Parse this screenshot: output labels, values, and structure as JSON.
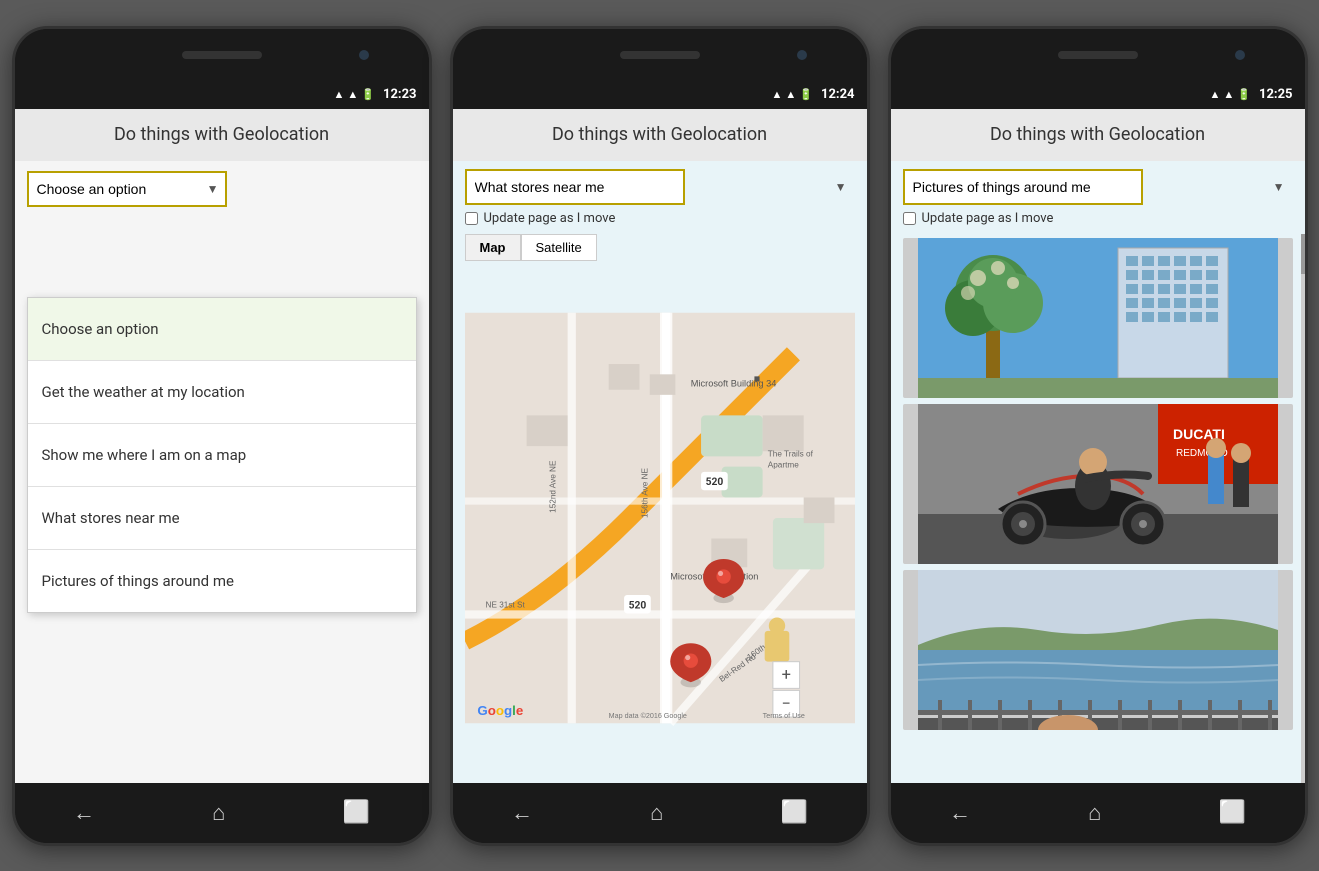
{
  "phones": [
    {
      "id": "phone1",
      "status_bar": {
        "time": "12:23"
      },
      "app_title": "Do things with Geolocation",
      "dropdown": {
        "label": "Choose an option",
        "arrow": "▼"
      },
      "options": [
        {
          "label": "Choose an option",
          "selected": true
        },
        {
          "label": "Get the weather at my location",
          "selected": false
        },
        {
          "label": "Show me where I am on a map",
          "selected": false
        },
        {
          "label": "What stores near me",
          "selected": false
        },
        {
          "label": "Pictures of things around me",
          "selected": false
        }
      ],
      "nav": {
        "back": "←",
        "home": "⌂",
        "recents": "⬜"
      }
    },
    {
      "id": "phone2",
      "status_bar": {
        "time": "12:24"
      },
      "app_title": "Do things with Geolocation",
      "dropdown": {
        "label": "What stores near me",
        "arrow": "▼"
      },
      "checkbox_label": "Update page as I move",
      "map_tabs": [
        "Map",
        "Satellite"
      ],
      "map_labels": {
        "microsoft_building": "Microsoft Building 34",
        "microsoft_corp": "Microsoft Corporation",
        "trails": "The Trails of Apartme",
        "google": "Google",
        "copyright": "Map data ©2016 Google",
        "terms": "Terms of Use",
        "road_520": "520",
        "road_520b": "520"
      },
      "nav": {
        "back": "←",
        "home": "⌂",
        "recents": "⬜"
      }
    },
    {
      "id": "phone3",
      "status_bar": {
        "time": "12:25"
      },
      "app_title": "Do things with Geolocation",
      "dropdown": {
        "label": "Pictures of things around me",
        "arrow": "▼"
      },
      "checkbox_label": "Update page as I move",
      "photos": [
        {
          "type": "building",
          "alt": "Building with trees"
        },
        {
          "type": "motorcycle",
          "alt": "Ducati motorcycle"
        },
        {
          "type": "water",
          "alt": "Water landscape"
        }
      ],
      "nav": {
        "back": "←",
        "home": "⌂",
        "recents": "⬜"
      }
    }
  ]
}
